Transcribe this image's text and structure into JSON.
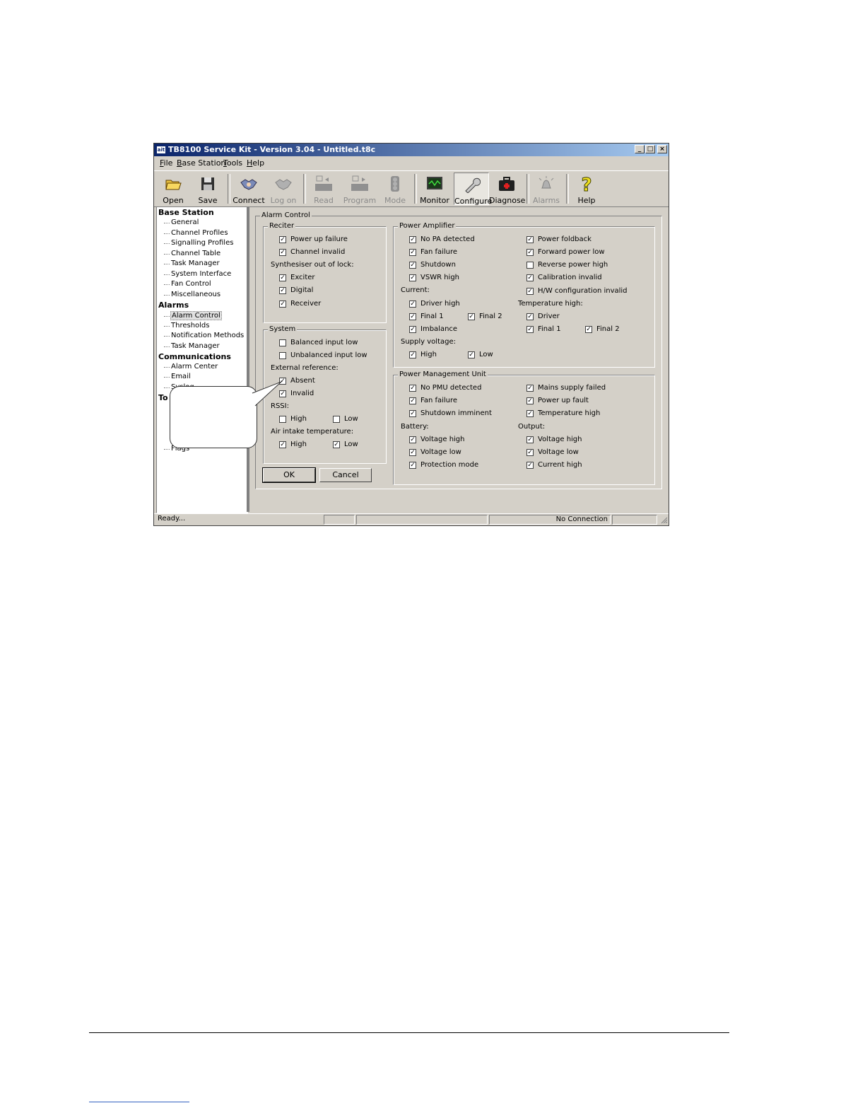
{
  "window": {
    "logo": "ait",
    "title": "TB8100 Service Kit - Version 3.04 - Untitled.t8c",
    "min": "_",
    "max": "□",
    "close": "×"
  },
  "menu": [
    "File",
    "Base Station",
    "Tools",
    "Help"
  ],
  "toolbar": [
    {
      "label": "Open",
      "icon": "open-folder-icon"
    },
    {
      "label": "Save",
      "icon": "floppy-disk-icon"
    },
    {
      "label": "Connect",
      "icon": "handshake-icon"
    },
    {
      "label": "Log on",
      "icon": "handshake-icon",
      "disabled": true
    },
    {
      "label": "Read",
      "icon": "read-icon",
      "disabled": true
    },
    {
      "label": "Program",
      "icon": "program-icon",
      "disabled": true
    },
    {
      "label": "Mode",
      "icon": "traffic-light-icon",
      "disabled": true
    },
    {
      "label": "Monitor",
      "icon": "monitor-icon"
    },
    {
      "label": "Configure",
      "icon": "wrench-icon",
      "active": true
    },
    {
      "label": "Diagnose",
      "icon": "medical-kit-icon"
    },
    {
      "label": "Alarms",
      "icon": "alarm-bell-icon",
      "disabled": true
    },
    {
      "label": "Help",
      "icon": "question-mark-icon"
    }
  ],
  "tree": {
    "base_station": "Base Station",
    "base_items": [
      "General",
      "Channel Profiles",
      "Signalling Profiles",
      "Channel Table",
      "Task Manager",
      "System Interface",
      "Fan Control",
      "Miscellaneous"
    ],
    "alarms": "Alarms",
    "alarm_items": [
      "Alarm Control",
      "Thresholds",
      "Notification Methods",
      "Task Manager"
    ],
    "communications": "Communications",
    "comm_items": [
      "Alarm Center",
      "Email",
      "Syslog"
    ],
    "tools_partial": "To",
    "flags": "Flags"
  },
  "alarm_control": {
    "title": "Alarm Control",
    "reciter": {
      "title": "Reciter",
      "power_up_failure": "Power up failure",
      "channel_invalid": "Channel invalid",
      "synth_label": "Synthesiser out of lock:",
      "exciter": "Exciter",
      "digital": "Digital",
      "receiver": "Receiver"
    },
    "system": {
      "title": "System",
      "balanced": "Balanced input low",
      "unbalanced": "Unbalanced input low",
      "ext_ref": "External reference:",
      "absent": "Absent",
      "invalid": "Invalid",
      "rssi": "RSSI:",
      "high": "High",
      "low": "Low",
      "air_intake": "Air intake temperature:"
    },
    "pa": {
      "title": "Power Amplifier",
      "no_pa": "No PA detected",
      "fan_failure": "Fan failure",
      "shutdown": "Shutdown",
      "vswr_high": "VSWR high",
      "current": "Current:",
      "driver_high": "Driver high",
      "final1": "Final 1",
      "final2": "Final 2",
      "imbalance": "Imbalance",
      "supply_voltage": "Supply voltage:",
      "high": "High",
      "low": "Low",
      "power_foldback": "Power foldback",
      "fwd_power_low": "Forward power low",
      "rev_power_high": "Reverse power high",
      "calibration_invalid": "Calibration invalid",
      "hw_config_invalid": "H/W configuration invalid",
      "temp_high": "Temperature high:",
      "driver": "Driver"
    },
    "pmu": {
      "title": "Power Management Unit",
      "no_pmu": "No PMU detected",
      "fan_failure": "Fan failure",
      "shutdown_imminent": "Shutdown imminent",
      "battery": "Battery:",
      "voltage_high": "Voltage high",
      "voltage_low": "Voltage low",
      "protection_mode": "Protection mode",
      "mains_failed": "Mains supply failed",
      "power_up_fault": "Power up fault",
      "temperature_high": "Temperature high",
      "output": "Output:",
      "current_high": "Current high"
    },
    "ok": "OK",
    "cancel": "Cancel"
  },
  "status": {
    "ready": "Ready...",
    "connection": "No Connection"
  },
  "check": "✓"
}
